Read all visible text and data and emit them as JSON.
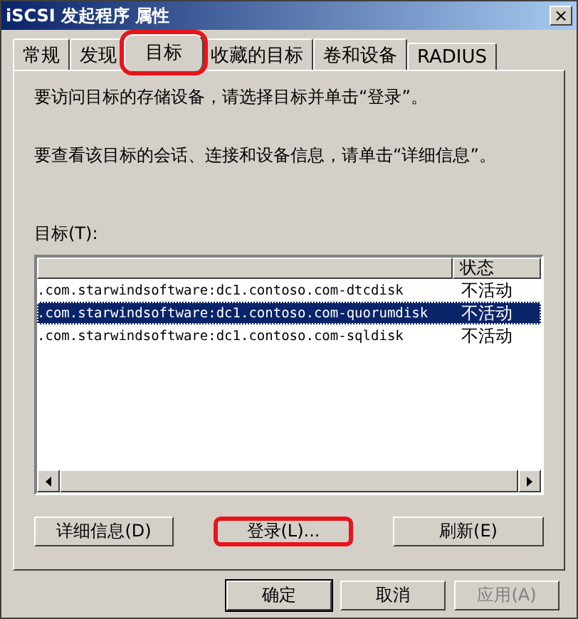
{
  "window": {
    "title": "iSCSI 发起程序 属性",
    "close": "×"
  },
  "tabs": [
    {
      "label": "常规",
      "selected": false,
      "highlighted": false
    },
    {
      "label": "发现",
      "selected": false,
      "highlighted": false
    },
    {
      "label": "目标",
      "selected": true,
      "highlighted": true
    },
    {
      "label": "收藏的目标",
      "selected": false,
      "highlighted": false
    },
    {
      "label": "卷和设备",
      "selected": false,
      "highlighted": false
    },
    {
      "label": "RADIUS",
      "selected": false,
      "highlighted": false
    }
  ],
  "instructions": [
    "要访问目标的存储设备，请选择目标并单击“登录”。",
    "要查看该目标的会话、连接和设备信息，请单击“详细信息”。"
  ],
  "targets_label": "目标(T):",
  "table": {
    "columns": [
      "状态"
    ],
    "rows": [
      {
        "name": ".com.starwindsoftware:dc1.contoso.com-dtcdisk",
        "status": "不活动",
        "selected": false
      },
      {
        "name": ".com.starwindsoftware:dc1.contoso.com-quorumdisk",
        "status": "不活动",
        "selected": true
      },
      {
        "name": ".com.starwindsoftware:dc1.contoso.com-sqldisk",
        "status": "不活动",
        "selected": false
      }
    ]
  },
  "actions": [
    {
      "label": "详细信息(D)",
      "highlighted": false
    },
    {
      "label": "登录(L)...",
      "highlighted": true
    },
    {
      "label": "刷新(E)",
      "highlighted": false
    }
  ],
  "footer": [
    {
      "label": "确定",
      "disabled": false,
      "default": true
    },
    {
      "label": "取消",
      "disabled": false,
      "default": false
    },
    {
      "label": "应用(A)",
      "disabled": true,
      "default": false
    }
  ]
}
